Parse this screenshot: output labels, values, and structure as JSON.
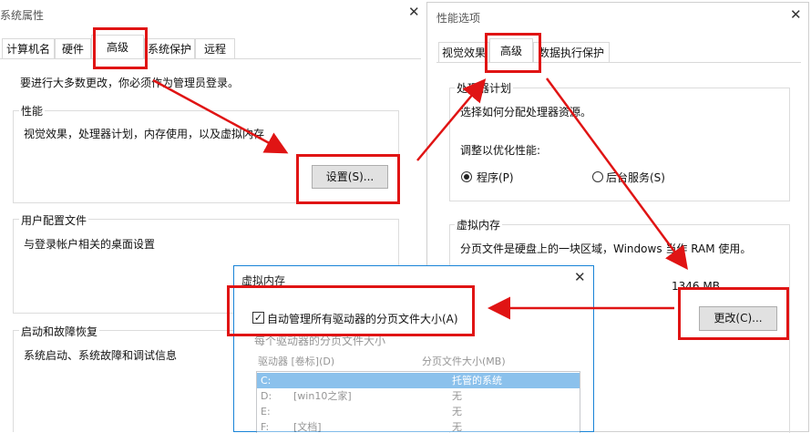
{
  "sysprops": {
    "title": "系统属性",
    "tabs": [
      "计算机名",
      "硬件",
      "高级",
      "系统保护",
      "远程"
    ],
    "notice": "要进行大多数更改，你必须作为管理员登录。",
    "perf_group": "性能",
    "perf_desc": "视觉效果，处理器计划，内存使用，以及虚拟内存",
    "settings_button": "设置(S)...",
    "profile_group": "用户配置文件",
    "profile_desc": "与登录帐户相关的桌面设置",
    "startup_group": "启动和故障恢复",
    "startup_desc": "系统启动、系统故障和调试信息"
  },
  "perfopts": {
    "title": "性能选项",
    "tabs": [
      "视觉效果",
      "高级",
      "数据执行保护"
    ],
    "sched_group": "处理器计划",
    "sched_desc": "选择如何分配处理器资源。",
    "adjust_label": "调整以优化性能:",
    "radio_programs": "程序(P)",
    "radio_services": "后台服务(S)",
    "vm_group": "虚拟内存",
    "vm_desc": "分页文件是硬盘上的一块区域，Windows 当作 RAM 使用。",
    "vm_size": "1346 MB",
    "change_button": "更改(C)..."
  },
  "vmem": {
    "title": "虚拟内存",
    "auto_manage_label": "自动管理所有驱动器的分页文件大小(A)",
    "auto_manage_checked": true,
    "per_drive_label": "每个驱动器的分页文件大小",
    "col_drive": "驱动器 [卷标](D)",
    "col_size": "分页文件大小(MB)",
    "drives": [
      {
        "drive": "C:",
        "label": "",
        "size": "托管的系统"
      },
      {
        "drive": "D:",
        "label": "[win10之家]",
        "size": "无"
      },
      {
        "drive": "E:",
        "label": "",
        "size": "无"
      },
      {
        "drive": "F:",
        "label": "[文档]",
        "size": "无"
      }
    ]
  },
  "colors": {
    "annotation": "#e01414",
    "selection": "#0078d7"
  }
}
